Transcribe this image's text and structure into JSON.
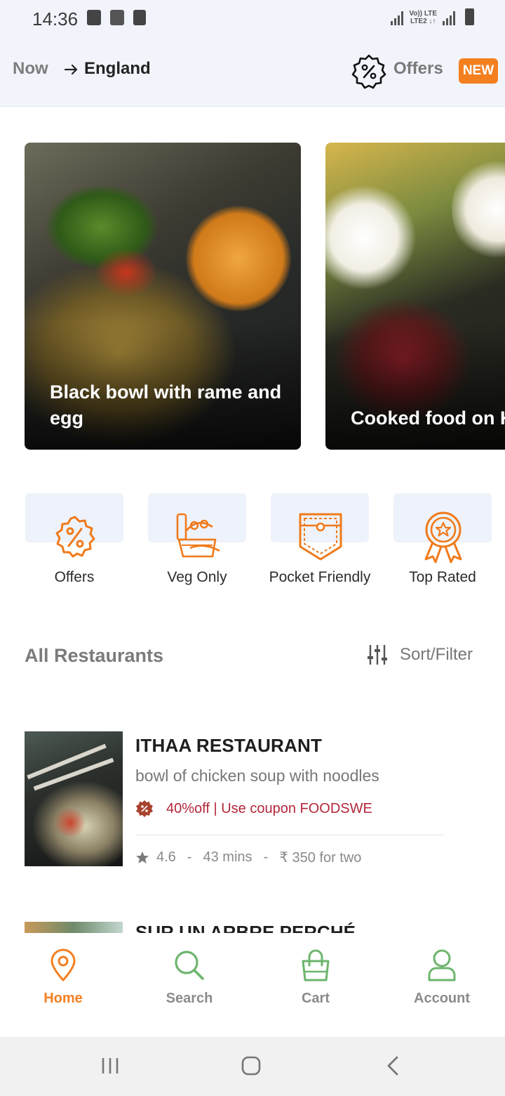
{
  "status_bar": {
    "time": "14:36",
    "lte_top": "Vo)) LTE",
    "lte_bottom": "LTE2 ↓↑"
  },
  "header": {
    "location_prefix": "Now",
    "location_name": "England",
    "offers_label": "Offers",
    "new_badge": "NEW",
    "icons": [
      "arrow-right-icon",
      "offer-badge-icon"
    ]
  },
  "carousel": [
    {
      "title": "Black bowl with rame and egg"
    },
    {
      "title": "Cooked food on Kahlo"
    }
  ],
  "categories": [
    {
      "label": "Offers",
      "icon": "offer-badge-icon"
    },
    {
      "label": "Veg Only",
      "icon": "veg-basket-icon"
    },
    {
      "label": "Pocket Friendly",
      "icon": "pocket-icon"
    },
    {
      "label": "Top Rated",
      "icon": "award-ribbon-icon"
    }
  ],
  "restaurants_section": {
    "title": "All Restaurants",
    "sort_label": "Sort/Filter"
  },
  "restaurants": [
    {
      "name": "ITHAA RESTAURANT",
      "description": "bowl of chicken soup with noodles",
      "offer": "40%off | Use coupon FOODSWE",
      "rating": "4.6",
      "time": "43 mins",
      "price": "₹ 350 for two",
      "sep": "-"
    },
    {
      "name": "SUR UN ARBRE PERCHÉ"
    }
  ],
  "bottom_nav": [
    {
      "label": "Home",
      "icon": "location-pin-icon",
      "active": true
    },
    {
      "label": "Search",
      "icon": "search-icon",
      "active": false
    },
    {
      "label": "Cart",
      "icon": "shopping-bag-icon",
      "active": false
    },
    {
      "label": "Account",
      "icon": "user-icon",
      "active": false
    }
  ],
  "colors": {
    "accent": "#f47f1f",
    "nav_green": "#6db56d",
    "offer_red": "#b3263a",
    "header_bg": "#f1f4fb"
  }
}
